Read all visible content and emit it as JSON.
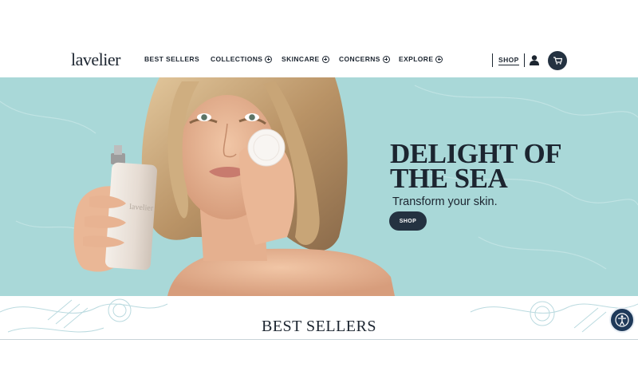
{
  "brand": {
    "logo_text": "lavelier"
  },
  "nav": {
    "items": [
      {
        "label": "BEST SELLERS",
        "has_plus": false
      },
      {
        "label": "COLLECTIONS",
        "has_plus": true
      },
      {
        "label": "SKINCARE",
        "has_plus": true
      },
      {
        "label": "CONCERNS",
        "has_plus": true
      },
      {
        "label": "EXPLORE",
        "has_plus": true
      }
    ],
    "shop_label": "SHOP",
    "user_icon": "user-icon",
    "cart_icon": "cart-icon"
  },
  "hero": {
    "title": "DELIGHT OF\nTHE SEA",
    "subtitle": "Transform your skin.",
    "button_label": "SHOP",
    "product_label": "lavelier",
    "colors": {
      "background": "#a9d8d8",
      "button": "#243241"
    }
  },
  "section": {
    "title": "BEST SELLERS"
  },
  "accessibility": {
    "icon": "accessibility-icon"
  }
}
